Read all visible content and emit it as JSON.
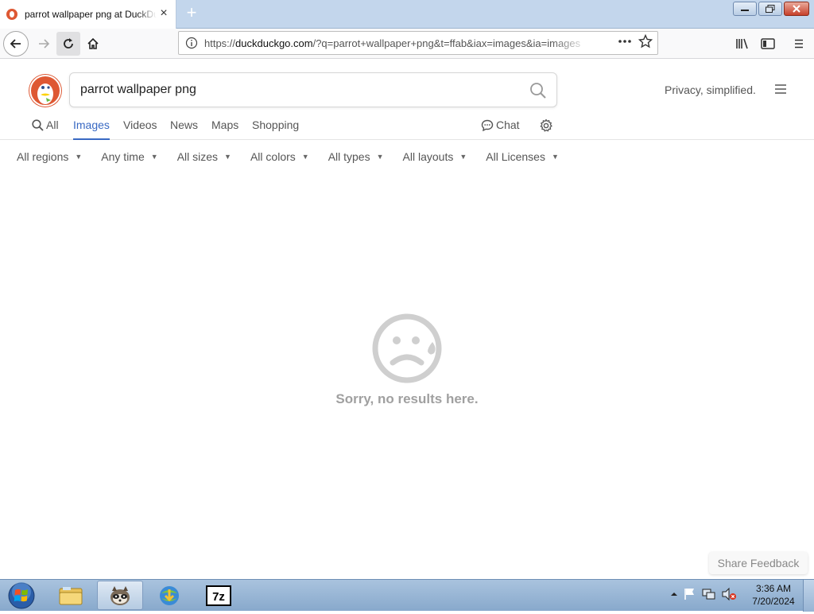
{
  "browser": {
    "tab_title": "parrot wallpaper png at DuckDuckGo",
    "url_prefix": "https://",
    "url_host": "duckduckgo.com",
    "url_path": "/?q=parrot+wallpaper+png&t=ffab&iax=images&ia=images"
  },
  "page": {
    "search_value": "parrot wallpaper png",
    "tagline": "Privacy, simplified.",
    "tabs": [
      {
        "label": "All",
        "active": false
      },
      {
        "label": "Images",
        "active": true
      },
      {
        "label": "Videos",
        "active": false
      },
      {
        "label": "News",
        "active": false
      },
      {
        "label": "Maps",
        "active": false
      },
      {
        "label": "Shopping",
        "active": false
      }
    ],
    "chat_label": "Chat",
    "filters": [
      "All regions",
      "Any time",
      "All sizes",
      "All colors",
      "All types",
      "All layouts",
      "All Licenses"
    ],
    "no_results": "Sorry, no results here.",
    "feedback_label": "Share Feedback"
  },
  "taskbar": {
    "time": "3:36 AM",
    "date": "7/20/2024",
    "apps": [
      "explorer-folder-icon",
      "firefox-raccoon-icon",
      "download-manager-icon",
      "7zip-icon"
    ]
  },
  "colors": {
    "accent": "#3969c3",
    "ddg_orange": "#de5833"
  }
}
